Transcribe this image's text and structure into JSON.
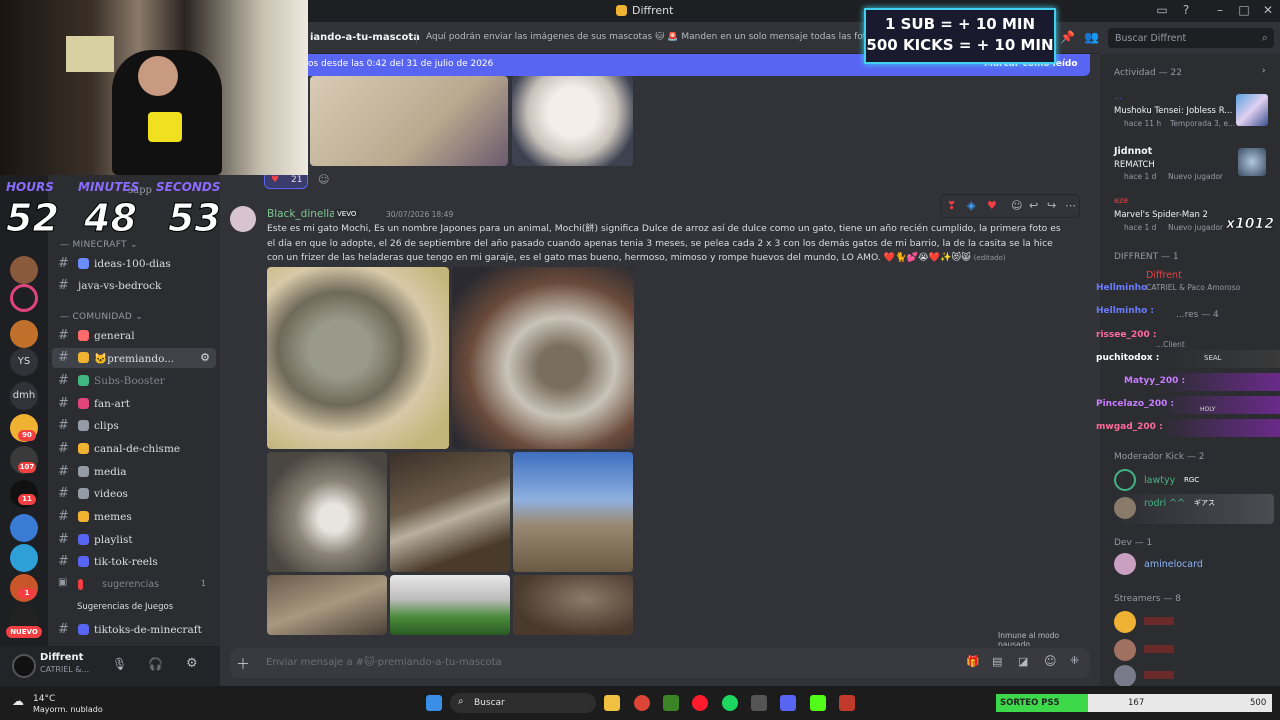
{
  "window": {
    "title": "Diffrent"
  },
  "overlay": {
    "sub_line1": "1 SUB = + 10 MIN",
    "sub_line2": "500 KICKS = + 10 MIN",
    "timer": {
      "hours_label": "HOURS",
      "minutes_label": "MINUTES",
      "seconds_label": "SECONDS",
      "hours": "52",
      "minutes": "48",
      "seconds": "53"
    },
    "sorteo": {
      "label": "SORTEO PS5",
      "current": "167",
      "goal": "500",
      "progress_fraction": 0.334
    },
    "chat": [
      {
        "name": "Hellminho",
        "color": "#6a7bff"
      },
      {
        "name": "Hellminho :",
        "color": "#6a7bff"
      },
      {
        "name": "rissee_200 :",
        "color": "#ff6b9a"
      },
      {
        "name": "puchitodox :",
        "color": "#ffffff"
      },
      {
        "name": "Matyy_200 :",
        "color": "#c77dff"
      },
      {
        "name": "Pincelazo_200 :",
        "color": "#c77dff"
      },
      {
        "name": "mwgad_200 :",
        "color": "#ff6b9a"
      }
    ],
    "chat_extra": {
      "seal": "SEAL",
      "holy": "HOLY"
    }
  },
  "header": {
    "channel": "iando-a-tu-mascota",
    "topic": "Aquí podrán enviar las imágenes de sus mascotas 🐱 🚨 Manden en un solo mensaje todas las fotos de s"
  },
  "banner": {
    "text": "os desde las 0:42 del 31 de julio de 2026",
    "action": "Marcar como leído"
  },
  "servers": {
    "ys": "YS",
    "dmh": "dmh",
    "badges": [
      "90",
      "107",
      "11",
      "1"
    ],
    "new_label": "NUEVO"
  },
  "sidebar": {
    "partial_channel": "sapp",
    "categories": {
      "minecraft": "MINECRAFT",
      "comunidad": "COMUNIDAD"
    },
    "channels": [
      {
        "label": "ideas-100-dias",
        "emo": "#6a8cff"
      },
      {
        "label": "java-vs-bedrock",
        "emo": ""
      },
      {
        "label": "general",
        "emo": "#ff6b6b"
      },
      {
        "label": "🐱premiando...",
        "emo": "#f0b232"
      },
      {
        "label": "Subs-Booster",
        "emo": "#43b581"
      },
      {
        "label": "fan-art",
        "emo": "#e0457b"
      },
      {
        "label": "clips",
        "emo": "#949ba4"
      },
      {
        "label": "canal-de-chisme",
        "emo": "#f0b232"
      },
      {
        "label": "media",
        "emo": "#949ba4"
      },
      {
        "label": "videos",
        "emo": "#949ba4"
      },
      {
        "label": "memes",
        "emo": "#f0b232"
      },
      {
        "label": "playlist",
        "emo": "#5865f2"
      },
      {
        "label": "tik-tok-reels",
        "emo": "#5865f2"
      },
      {
        "label": "sugerencias",
        "emo": "#f23f42"
      },
      {
        "label": "Sugerencias de Juegos",
        "emo": ""
      },
      {
        "label": "tiktoks-de-minecraft",
        "emo": "#5865f2"
      }
    ],
    "sugerencias_count": "1"
  },
  "user": {
    "name": "Diffrent",
    "status": "CATRIEL &..."
  },
  "message": {
    "reaction_count": "21",
    "author": "Black_dinella",
    "tag": "VEVO",
    "timestamp": "30/07/2026 18:49",
    "body": "Este es mi gato Mochi, Es un nombre Japones para un animal, Mochi(餅) significa Dulce de arroz así de dulce como un gato, tiene un año recién cumplido, la primera foto es el día en que lo adopte, el 26 de septiembre del año pasado cuando apenas tenia 3 meses, se pelea cada 2 x 3 con los demás gatos de mi barrio, la de la casita se la hice con un frizer de las heladeras que tengo en mi garaje, es el gato mas bueno, hermoso, mimoso y rompe huevos del mundo, LO AMO. ❤️🐈💕😭❤️✨😻😸",
    "edited": "(editado)"
  },
  "composer": {
    "placeholder": "Enviar mensaje a #🐱·premiando-a-tu-mascota",
    "paused": "Inmune al modo pausado"
  },
  "members": {
    "search_placeholder": "Buscar Diffrent",
    "activity_header": "Actividad — 22",
    "activities": [
      {
        "name": "Mushoku Tensei: Jobless R...",
        "user": "...",
        "meta": "hace 11 h",
        "meta2": "Temporada 3, e..."
      },
      {
        "name": "REMATCH",
        "user": "Jidnnot",
        "meta": "hace 1 d",
        "meta2": "Nuevo jugador"
      },
      {
        "name": "Marvel's Spider-Man 2",
        "user": "eze",
        "meta": "hace 1 d",
        "meta2": "Nuevo jugador"
      }
    ],
    "combo": "x1012",
    "groups": [
      {
        "header": "DIFFRENT — 1"
      },
      {
        "header": "Moderador Kick — 2"
      },
      {
        "header": "Dev — 1"
      },
      {
        "header": "Streamers — 8"
      }
    ],
    "diffrent_member": "Diffrent",
    "diffrent_sub": "CATRIEL & Paco Amoroso",
    "hidden_header": "...res — 4",
    "hidden_sub": "...Client",
    "mods": [
      {
        "name": "lawtyy",
        "tag": "RGC"
      },
      {
        "name": "rodri ^^",
        "tag": "ギアス"
      }
    ],
    "dev": "aminelocard"
  },
  "taskbar": {
    "weather_temp": "14°C",
    "weather_desc": "Mayorm. nublado",
    "search": "Buscar"
  }
}
